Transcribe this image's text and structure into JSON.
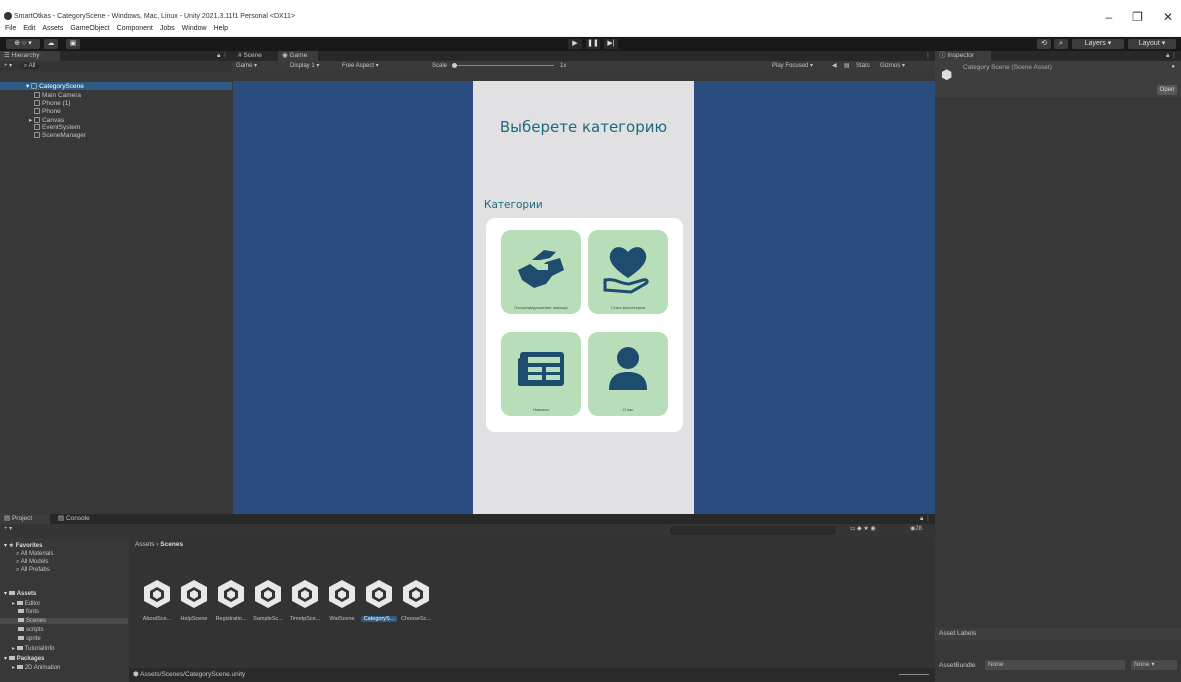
{
  "window": {
    "title": "SmartOtkas - CategoryScene - Windows, Mac, Linux - Unity 2021.3.11f1 Personal <DX11>",
    "menu": [
      "File",
      "Edit",
      "Assets",
      "GameObject",
      "Component",
      "Jobs",
      "Window",
      "Help"
    ],
    "controls": [
      "–",
      "❐",
      "✕"
    ]
  },
  "toolbar": {
    "layers_label": "Layers",
    "layout_label": "Layout"
  },
  "hierarchy": {
    "tab": "Hierarchy",
    "search": "All",
    "scene": "CategoryScene",
    "items": [
      "Main Camera",
      "Phone (1)",
      "Phone",
      "Canvas",
      "EventSystem",
      "SceneManager"
    ]
  },
  "scene_tabs": {
    "scene": "Scene",
    "game": "Game"
  },
  "game_bar": {
    "mode": "Game",
    "display": "Display 1",
    "aspect": "Free Aspect",
    "scale_label": "Scale",
    "scale_value": "1x",
    "play_focused": "Play Focused",
    "stats": "Stats",
    "gizmos": "Gizmos"
  },
  "app": {
    "title": "Выберете категорию",
    "subtitle": "Категории",
    "categories": [
      {
        "label": "Поиск/предложение помощи",
        "icon": "handshake-icon"
      },
      {
        "label": "Стать волонтером",
        "icon": "heart-hand-icon"
      },
      {
        "label": "Новости",
        "icon": "news-icon"
      },
      {
        "label": "О нас",
        "icon": "person-icon"
      }
    ]
  },
  "inspector": {
    "tab": "Inspector",
    "asset_name": "Category Scene (Scene Asset)",
    "open_button": "Open",
    "asset_labels": "Asset Labels",
    "asset_bundle": "AssetBundle",
    "bundle_value": "None",
    "bundle_variant": "None"
  },
  "project": {
    "tabs": [
      "Project",
      "Console"
    ],
    "breadcrumb": [
      "Assets",
      "Scenes"
    ],
    "favorites_title": "Favorites",
    "favorites": [
      "All Materials",
      "All Models",
      "All Prefabs"
    ],
    "assets_title": "Assets",
    "folders": [
      "Editor",
      "fonts",
      "Scenes",
      "scripts",
      "sprite",
      "TutorialInfo"
    ],
    "packages_title": "Packages",
    "packages_first": "2D Animation",
    "scenes": [
      "AboutSce...",
      "HelpScene",
      "Registratio...",
      "SampleSc...",
      "TimetpSce...",
      "WatScene",
      "CategoryS...",
      "ChooseSc..."
    ],
    "selected_scene_index": 6,
    "status_path": "Assets/Scenes/CategoryScene.unity",
    "icon_count": "28"
  }
}
